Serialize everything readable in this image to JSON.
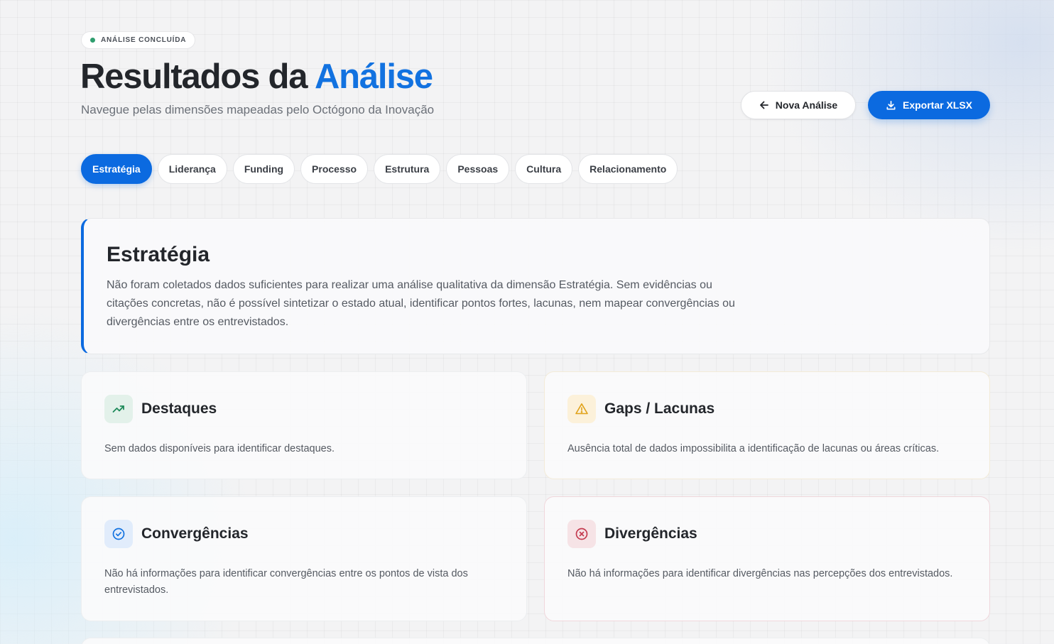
{
  "header": {
    "status_badge": "ANÁLISE CONCLUÍDA",
    "title_prefix": "Resultados da",
    "title_accent": "Análise",
    "subtitle": "Navegue pelas dimensões mapeadas pelo Octógono da Inovação"
  },
  "actions": {
    "new_analysis": "Nova Análise",
    "export": "Exportar XLSX"
  },
  "tabs": [
    {
      "label": "Estratégia",
      "active": true
    },
    {
      "label": "Liderança",
      "active": false
    },
    {
      "label": "Funding",
      "active": false
    },
    {
      "label": "Processo",
      "active": false
    },
    {
      "label": "Estrutura",
      "active": false
    },
    {
      "label": "Pessoas",
      "active": false
    },
    {
      "label": "Cultura",
      "active": false
    },
    {
      "label": "Relacionamento",
      "active": false
    }
  ],
  "summary": {
    "title": "Estratégia",
    "text": "Não foram coletados dados suficientes para realizar uma análise qualitativa da dimensão Estratégia. Sem evidências ou citações concretas, não é possível sintetizar o estado atual, identificar pontos fortes, lacunas, nem mapear convergências ou divergências entre os entrevistados."
  },
  "cards": {
    "highlights": {
      "title": "Destaques",
      "text": "Sem dados disponíveis para identificar destaques.",
      "icon": "trending-up-icon",
      "color": "#1e8a5a"
    },
    "gaps": {
      "title": "Gaps / Lacunas",
      "text": "Ausência total de dados impossibilita a identificação de lacunas ou áreas críticas.",
      "icon": "warning-icon",
      "color": "#e0a21a"
    },
    "convergences": {
      "title": "Convergências",
      "text": "Não há informações para identificar convergências entre os pontos de vista dos entrevistados.",
      "icon": "check-circle-icon",
      "color": "#1272e0"
    },
    "divergences": {
      "title": "Divergências",
      "text": "Não há informações para identificar divergências nas percepções dos entrevistados.",
      "icon": "x-circle-icon",
      "color": "#c43a4f"
    }
  }
}
